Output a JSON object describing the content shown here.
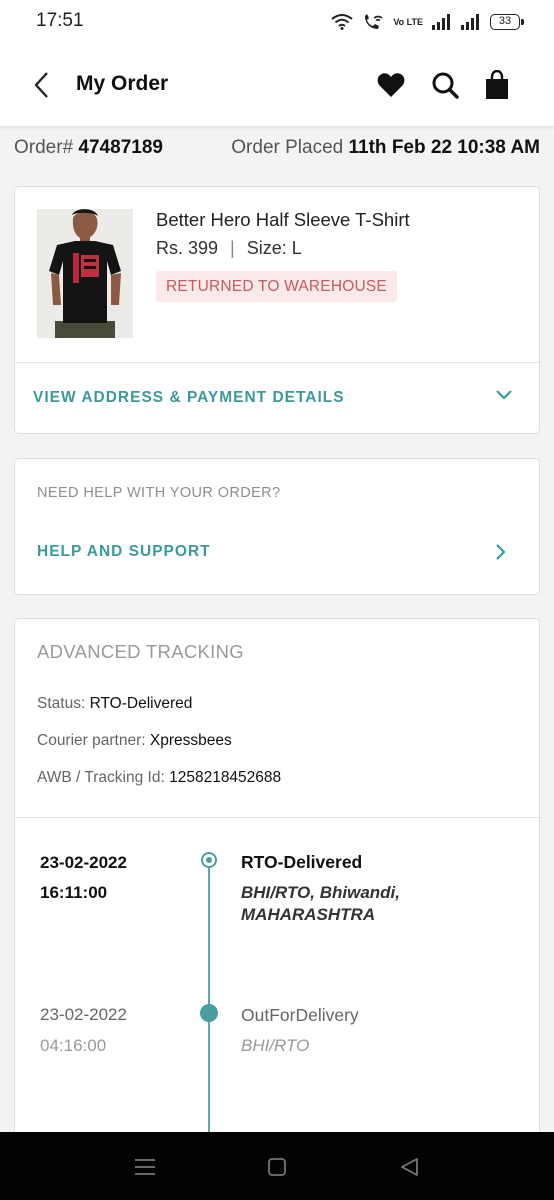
{
  "status_bar": {
    "time": "17:51",
    "volte": "Vo LTE",
    "battery": "33"
  },
  "header": {
    "title": "My Order"
  },
  "order": {
    "number_label": "Order#",
    "number": "47487189",
    "placed_label": "Order Placed",
    "placed_date": "11th Feb 22 10:38 AM"
  },
  "product": {
    "name": "Better Hero Half Sleeve T-Shirt",
    "price": "Rs. 399",
    "separator": "|",
    "size": "Size: L",
    "status": "RETURNED TO WAREHOUSE"
  },
  "details_link": "VIEW ADDRESS & PAYMENT DETAILS",
  "help": {
    "heading": "NEED HELP WITH YOUR ORDER?",
    "link": "HELP AND SUPPORT"
  },
  "tracking": {
    "title": "ADVANCED TRACKING",
    "status_label": "Status:",
    "status_value": "RTO-Delivered",
    "courier_label": "Courier partner:",
    "courier_value": "Xpressbees",
    "awb_label": "AWB / Tracking Id:",
    "awb_value": "1258218452688",
    "events": [
      {
        "date": "23-02-2022",
        "time": "16:11:00",
        "status": "RTO-Delivered",
        "location": "BHI/RTO, Bhiwandi, MAHARASHTRA"
      },
      {
        "date": "23-02-2022",
        "time": "04:16:00",
        "status": "OutForDelivery",
        "location": "BHI/RTO"
      }
    ]
  },
  "colors": {
    "accent": "#3c999a",
    "badge_bg": "#fbe9ea",
    "badge_text": "#c65a63"
  },
  "icons": [
    "back-arrow-icon",
    "heart-icon",
    "search-icon",
    "shopping-bag-icon",
    "chevron-down-icon",
    "chevron-right-icon",
    "menu-icon",
    "home-square-icon",
    "back-triangle-icon"
  ]
}
